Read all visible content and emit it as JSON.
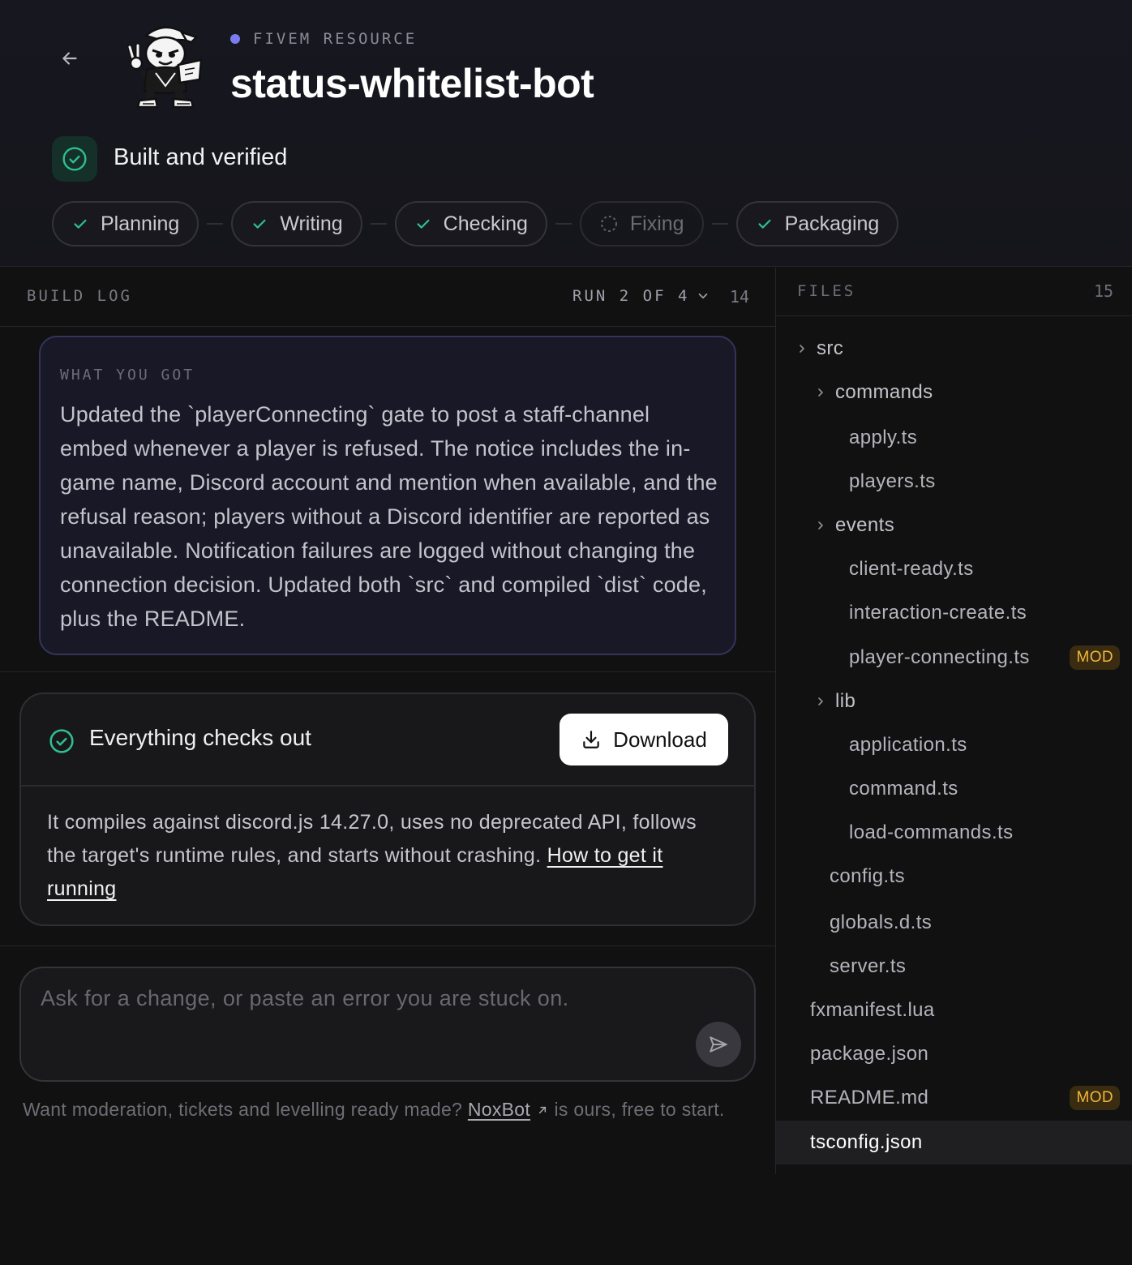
{
  "header": {
    "back_icon": "arrow-left-icon",
    "resource_type": "FIVEM RESOURCE",
    "title": "status-whitelist-bot",
    "status": "Built and verified",
    "accent": "#7b7cf0",
    "success": "#2fbf8f"
  },
  "steps": [
    {
      "label": "Planning",
      "state": "done"
    },
    {
      "label": "Writing",
      "state": "done"
    },
    {
      "label": "Checking",
      "state": "done"
    },
    {
      "label": "Fixing",
      "state": "pending"
    },
    {
      "label": "Packaging",
      "state": "done"
    }
  ],
  "build_log": {
    "title": "BUILD LOG",
    "run": "RUN 2 OF 4",
    "count": "14",
    "summary_label": "WHAT YOU GOT",
    "summary": "Updated the `playerConnecting` gate to post a staff-channel embed whenever a player is refused. The notice includes the in-game name, Discord account and mention when available, and the refusal reason; players without a Discord identifier are reported as unavailable. Notification failures are logged without changing the connection decision. Updated both `src` and compiled `dist` code, plus the README."
  },
  "check": {
    "title": "Everything checks out",
    "download_label": "Download",
    "body": "It compiles against discord.js 14.27.0, uses no deprecated API, follows the target's runtime rules, and starts without crashing. ",
    "link": "How to get it running"
  },
  "composer": {
    "placeholder": "Ask for a change, or paste an error you are stuck on."
  },
  "promo": {
    "before": "Want moderation, tickets and levelling ready made? ",
    "link": "NoxBot",
    "after": " is ours, free to start."
  },
  "files": {
    "title": "FILES",
    "count": "15",
    "mod_label": "MOD",
    "tree": [
      {
        "name": "src",
        "depth": 0,
        "dir": true
      },
      {
        "name": "commands",
        "depth": 1,
        "dir": true
      },
      {
        "name": "apply.ts",
        "depth": 2
      },
      {
        "name": "players.ts",
        "depth": 2
      },
      {
        "name": "events",
        "depth": 1,
        "dir": true
      },
      {
        "name": "client-ready.ts",
        "depth": 2
      },
      {
        "name": "interaction-create.ts",
        "depth": 2
      },
      {
        "name": "player-connecting.ts",
        "depth": 2,
        "modified": true
      },
      {
        "name": "lib",
        "depth": 1,
        "dir": true
      },
      {
        "name": "application.ts",
        "depth": 2
      },
      {
        "name": "command.ts",
        "depth": 2
      },
      {
        "name": "load-commands.ts",
        "depth": 2
      },
      {
        "name": "config.ts",
        "depth": 1
      },
      {
        "name": "globals.d.ts",
        "depth": 1
      },
      {
        "name": "server.ts",
        "depth": 1
      },
      {
        "name": "fxmanifest.lua",
        "depth": 0
      },
      {
        "name": "package.json",
        "depth": 0
      },
      {
        "name": "README.md",
        "depth": 0,
        "modified": true
      },
      {
        "name": "tsconfig.json",
        "depth": 0,
        "selected": true
      }
    ]
  }
}
